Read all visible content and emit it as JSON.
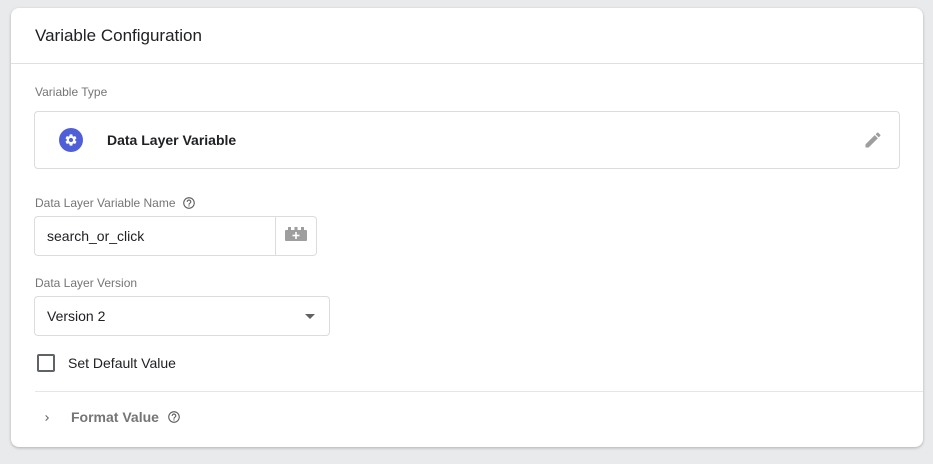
{
  "card": {
    "title": "Variable Configuration"
  },
  "variable_type": {
    "section_label": "Variable Type",
    "name": "Data Layer Variable",
    "icon": "gear-icon",
    "icon_color": "#4f5fd8"
  },
  "variable_name": {
    "label": "Data Layer Variable Name",
    "value": "search_or_click"
  },
  "version": {
    "label": "Data Layer Version",
    "selected": "Version 2"
  },
  "default_value": {
    "label": "Set Default Value",
    "checked": false
  },
  "format_value": {
    "label": "Format Value"
  }
}
